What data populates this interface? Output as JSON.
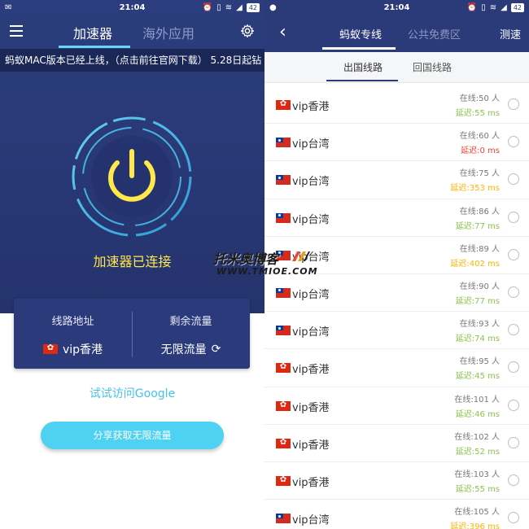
{
  "left": {
    "status": {
      "time": "21:04",
      "battery": "42"
    },
    "tabs": {
      "active": "加速器",
      "inactive": "海外应用"
    },
    "ticker": "蚂蚁MAC版本已经上线，（点击前往官网下载） 5.28日起钻",
    "status_text": "加速器已连接",
    "route_label": "线路地址",
    "route_value": "vip香港",
    "traffic_label": "剩余流量",
    "traffic_value": "无限流量",
    "google_link": "试试访问Google",
    "share_button": "分享获取无限流量"
  },
  "right": {
    "status": {
      "time": "21:04",
      "battery": "42"
    },
    "tabs": {
      "active": "蚂蚁专线",
      "inactive": "公共免费区"
    },
    "speed_test": "测速",
    "subtabs": {
      "outbound": "出国线路",
      "inbound": "回国线路"
    },
    "servers": [
      {
        "flag": "hk",
        "name": "vip香港",
        "online": "在线:50 人",
        "delay": "延迟:55 ms",
        "delay_color": "#8bc34a"
      },
      {
        "flag": "tw",
        "name": "vip台湾",
        "online": "在线:60 人",
        "delay": "延迟:0 ms",
        "delay_color": "#f44336"
      },
      {
        "flag": "tw",
        "name": "vip台湾",
        "online": "在线:75 人",
        "delay": "延迟:353 ms",
        "delay_color": "#ffb300"
      },
      {
        "flag": "tw",
        "name": "vip台湾",
        "online": "在线:86 人",
        "delay": "延迟:77 ms",
        "delay_color": "#8bc34a"
      },
      {
        "flag": "tw",
        "name": "vip台湾",
        "online": "在线:89 人",
        "delay": "延迟:402 ms",
        "delay_color": "#ffb300"
      },
      {
        "flag": "tw",
        "name": "vip台湾",
        "online": "在线:90 人",
        "delay": "延迟:77 ms",
        "delay_color": "#8bc34a"
      },
      {
        "flag": "tw",
        "name": "vip台湾",
        "online": "在线:93 人",
        "delay": "延迟:74 ms",
        "delay_color": "#8bc34a"
      },
      {
        "flag": "hk",
        "name": "vip香港",
        "online": "在线:95 人",
        "delay": "延迟:45 ms",
        "delay_color": "#8bc34a"
      },
      {
        "flag": "hk",
        "name": "vip香港",
        "online": "在线:101 人",
        "delay": "延迟:46 ms",
        "delay_color": "#8bc34a"
      },
      {
        "flag": "hk",
        "name": "vip香港",
        "online": "在线:102 人",
        "delay": "延迟:52 ms",
        "delay_color": "#8bc34a"
      },
      {
        "flag": "hk",
        "name": "vip香港",
        "online": "在线:103 人",
        "delay": "延迟:55 ms",
        "delay_color": "#8bc34a"
      },
      {
        "flag": "tw",
        "name": "vip台湾",
        "online": "在线:105 人",
        "delay": "延迟:396 ms",
        "delay_color": "#ffb300"
      }
    ]
  },
  "watermark": {
    "line1": "托米奥博客",
    "line2": "WWW.TMIOE.COM"
  },
  "colors": {
    "accent": "#4fd2f1",
    "header": "#2b3a78",
    "power": "#ffe84a"
  }
}
